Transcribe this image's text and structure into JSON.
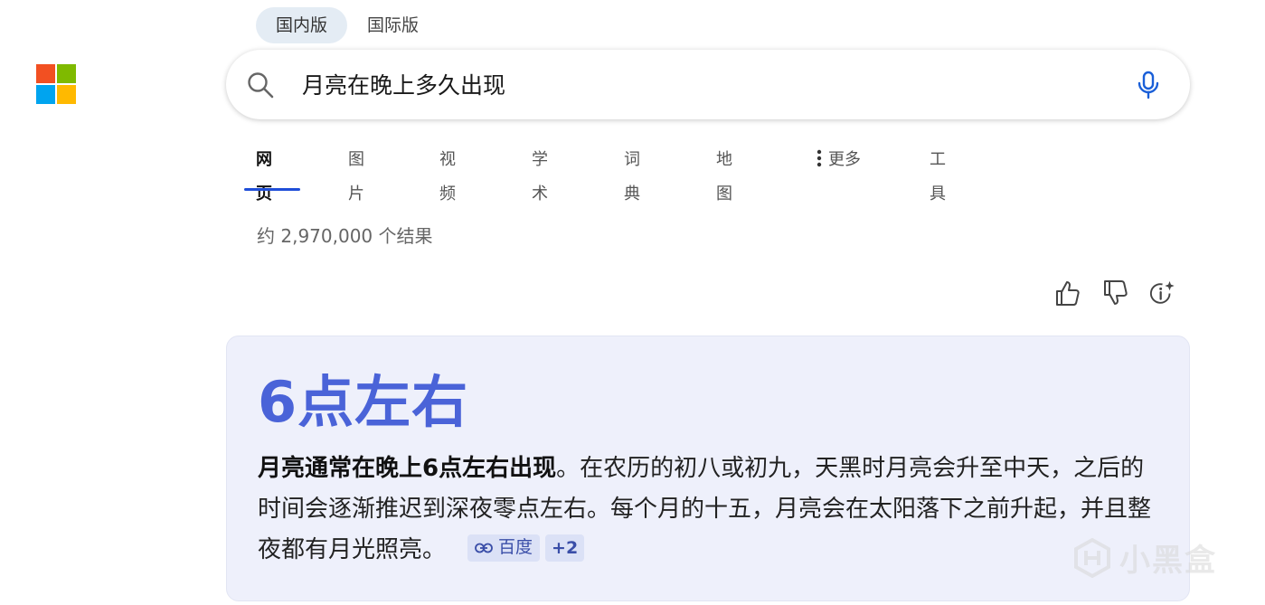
{
  "logo": {
    "name": "microsoft-logo",
    "colors": [
      "#f25022",
      "#7fba00",
      "#00a4ef",
      "#ffb900"
    ]
  },
  "region_tabs": [
    {
      "label": "国内版",
      "active": true
    },
    {
      "label": "国际版",
      "active": false
    }
  ],
  "search": {
    "value": "月亮在晚上多久出现",
    "search_icon": "search-icon",
    "mic_icon": "microphone-icon"
  },
  "nav": {
    "items": [
      {
        "label": "网页",
        "active": true
      },
      {
        "label": "图片"
      },
      {
        "label": "视频"
      },
      {
        "label": "学术"
      },
      {
        "label": "词典"
      },
      {
        "label": "地图"
      },
      {
        "label": "更多",
        "icon": "kebab-icon"
      },
      {
        "label": "工具"
      }
    ]
  },
  "results": {
    "count_text": "约 2,970,000 个结果"
  },
  "feedback": {
    "icons": [
      "thumbs-up-icon",
      "thumbs-down-icon",
      "ai-info-icon"
    ]
  },
  "answer": {
    "title": "6点左右",
    "bold_lead": "月亮通常在晚上6点左右出现",
    "body": "。在农历的初八或初九，天黑时月亮会升至中天，之后的时间会逐渐推迟到深夜零点左右。每个月的十五，月亮会在太阳落下之前升起，并且整夜都有月光照亮。",
    "citation": {
      "source": "百度",
      "more": "+2",
      "icon": "link-icon"
    }
  },
  "watermark": {
    "text": "小黑盒",
    "icon": "heybox-logo"
  },
  "colors": {
    "accent": "#1f4ed8",
    "answer_title": "#4a63d8",
    "card_bg": "#eef0fb",
    "mic": "#1a5fd8"
  }
}
